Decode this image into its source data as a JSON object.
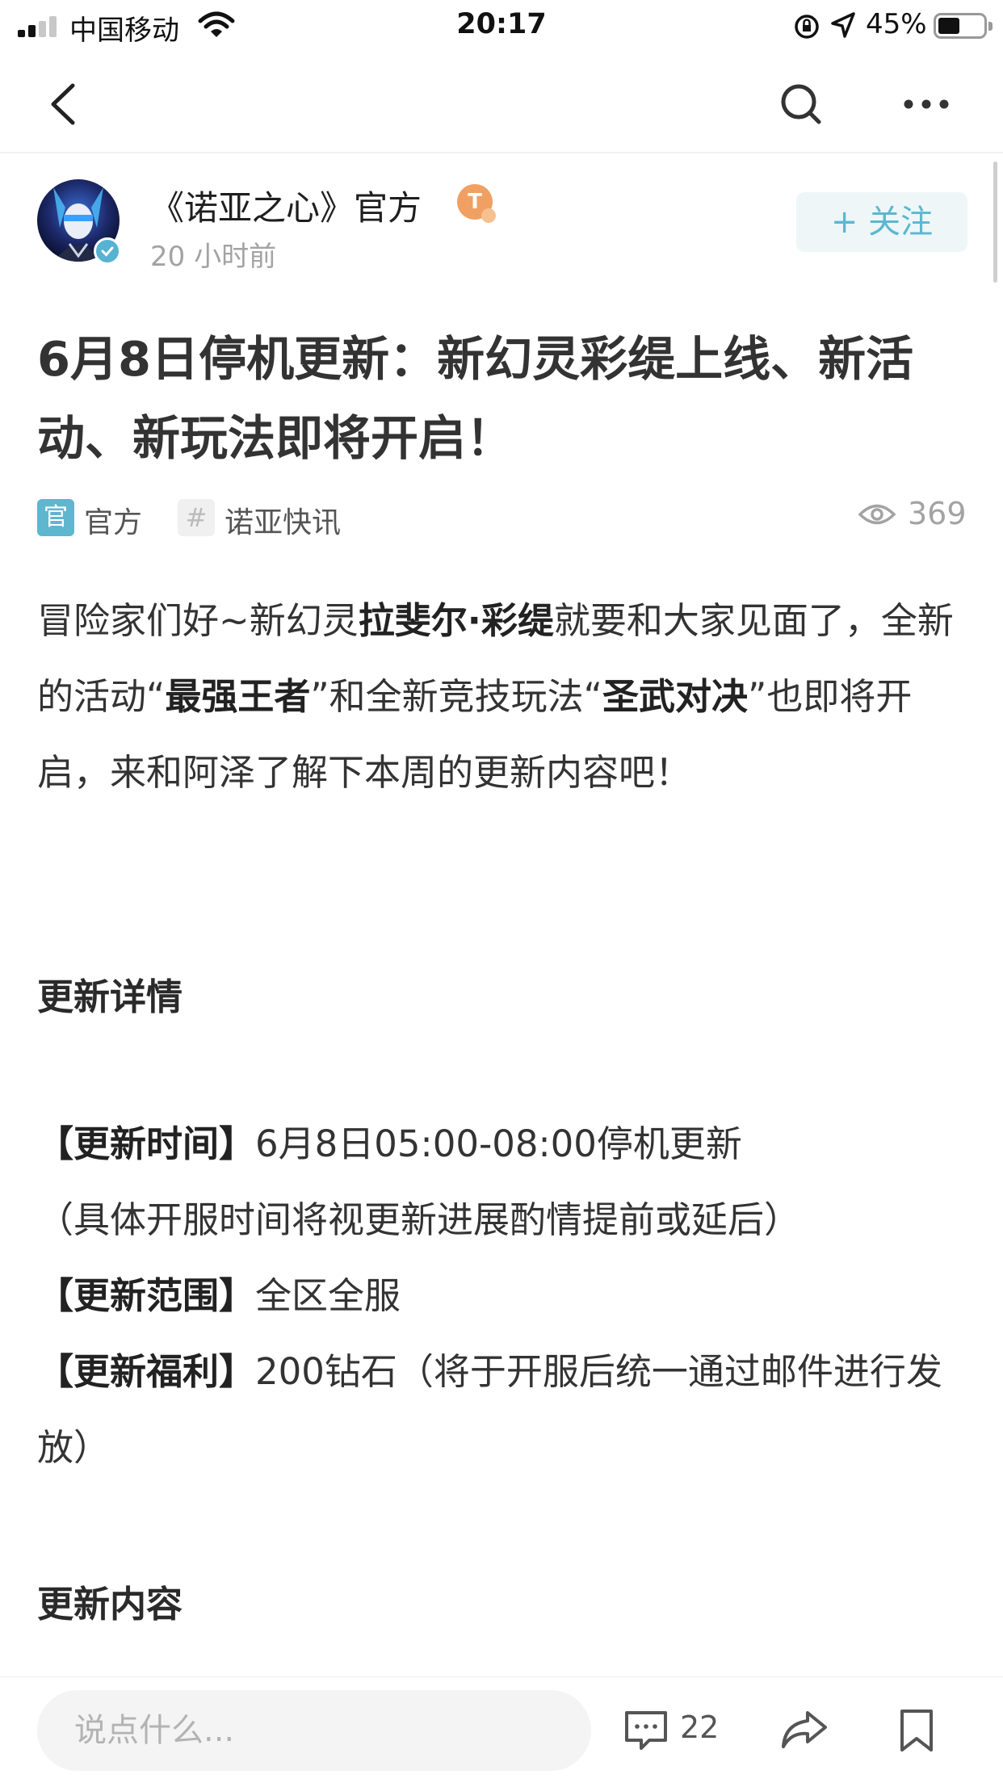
{
  "status_bar": {
    "carrier": "中国移动",
    "time": "20:17",
    "battery": "45%",
    "battery_level": 0.45
  },
  "nav": {
    "back_icon": "back-chevron-icon",
    "search_icon": "search-icon",
    "more_icon": "more-dots-icon"
  },
  "author": {
    "name": "《诺亚之心》官方",
    "time": "20 小时前",
    "badge": "T",
    "follow_label": "+ 关注"
  },
  "post": {
    "title": "6月8日停机更新：新幻灵彩缇上线、新活动、新玩法即将开启！",
    "tag_official_icon": "官",
    "tag_official": "官方",
    "tag_topic_icon": "#",
    "tag_topic": "诺亚快讯",
    "views": "369",
    "intro": {
      "p1": "冒险家们好~新幻灵",
      "b1": "拉斐尔·彩缇",
      "p2": "就要和大家见面了，全新的活动“",
      "b2": "最强王者",
      "p3": "”和全新竞技玩法“",
      "b3": "圣武对决",
      "p4": "”也即将开启，来和阿泽了解下本周的更新内容吧！"
    },
    "heading_details": "更新详情",
    "info": {
      "time_label": "【更新时间】",
      "time_value": "6月8日05:00-08:00停机更新",
      "time_note": "（具体开服时间将视更新进展酌情提前或延后）",
      "range_label": "【更新范围】",
      "range_value": "全区全服",
      "reward_label": "【更新福利】",
      "reward_value": "200钻石（将于开服后统一通过邮件进行发放）"
    },
    "heading_content": "更新内容"
  },
  "bottom_bar": {
    "comment_placeholder": "说点什么...",
    "comments_count": "22"
  },
  "colors": {
    "accent": "#5db7cf",
    "text": "#333333",
    "muted": "#a3a3a3"
  }
}
